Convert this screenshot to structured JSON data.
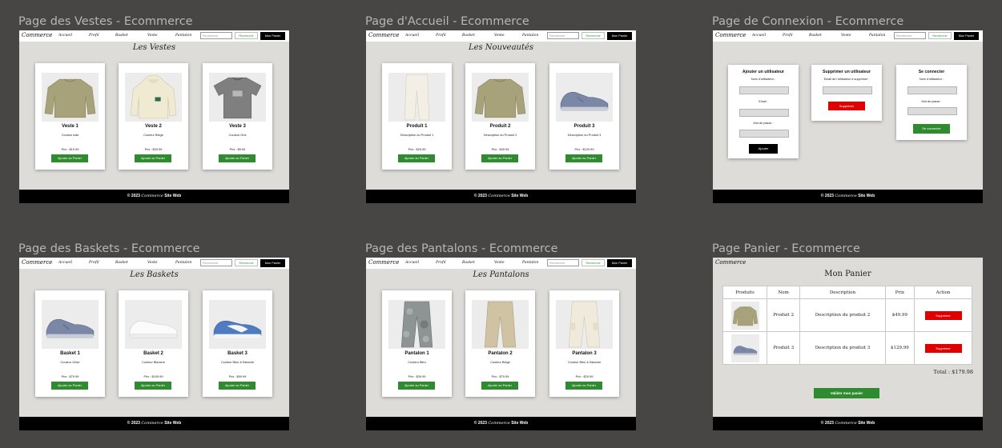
{
  "frames": [
    {
      "title": "Page des Vestes - Ecommerce",
      "heading": "Les Vestes",
      "products": [
        {
          "name": "Veste 1",
          "desc": "Couleur kaki",
          "price": "Prix : $19.99",
          "image": "sweater-khaki"
        },
        {
          "name": "Veste 2",
          "desc": "Couleur Beige",
          "price": "Prix : $29.99",
          "image": "hoodie-beige"
        },
        {
          "name": "Veste 3",
          "desc": "Couleur Gris",
          "price": "Prix : $9.99",
          "image": "tshirt-grey"
        }
      ]
    },
    {
      "title": "Page d'Accueil - Ecommerce",
      "heading": "Les Nouveautés",
      "products": [
        {
          "name": "Produit 1",
          "desc": "Description du Produit 1",
          "price": "Prix : $29.99",
          "image": "pants-white"
        },
        {
          "name": "Produit 2",
          "desc": "Description du Produit 2",
          "price": "Prix : $49.99",
          "image": "sweater-khaki"
        },
        {
          "name": "Produit 3",
          "desc": "Description du Produit 3",
          "price": "Prix : $129.99",
          "image": "sneaker-grey"
        }
      ]
    },
    {
      "title": "Page de Connexion - Ecommerce"
    },
    {
      "title": "Page des Baskets - Ecommerce",
      "heading": "Les Baskets",
      "products": [
        {
          "name": "Basket 1",
          "desc": "Couleur Grise",
          "price": "Prix : $79.99",
          "image": "sneaker-grey"
        },
        {
          "name": "Basket 2",
          "desc": "Couleur Blanche",
          "price": "Prix : $109.99",
          "image": "sneaker-white"
        },
        {
          "name": "Basket 3",
          "desc": "Couleur Bleu & Blanche",
          "price": "Prix : $99.99",
          "image": "sneaker-blue"
        }
      ]
    },
    {
      "title": "Page des Pantalons - Ecommerce",
      "heading": "Les Pantalons",
      "products": [
        {
          "name": "Pantalon 1",
          "desc": "Couleur Bleu",
          "price": "Prix : $39.99",
          "image": "pants-camo"
        },
        {
          "name": "Pantalon 2",
          "desc": "Couleur Beige",
          "price": "Prix : $79.99",
          "image": "pants-beige"
        },
        {
          "name": "Pantalon 3",
          "desc": "Couleur Bleu & Blanche",
          "price": "Prix : $29.99",
          "image": "pants-cream"
        }
      ]
    },
    {
      "title": "Page Panier - Ecommerce"
    }
  ],
  "nav": {
    "logo": "Commerce",
    "links": [
      "Accueil",
      "Profil",
      "Basket",
      "Veste",
      "Pantalon"
    ],
    "search_placeholder": "Rechercher",
    "search_button": "Recherche",
    "cart_button": "Mon Panier"
  },
  "common": {
    "add_to_cart": "Ajouter au Panier",
    "footer_year": "© 2023",
    "footer_logo": "Commerce",
    "footer_site": "Site Web"
  },
  "login": {
    "add_user": {
      "title": "Ajouter un utilisateur",
      "name_label": "Nom d'utilisateur :",
      "email_label": "Email :",
      "password_label": "Mot de passe :",
      "button": "Ajouter"
    },
    "delete_user": {
      "title": "Supprimer un utilisateur",
      "email_label": "Email de l'utilisateur à supprimer :",
      "button": "Supprimer"
    },
    "connect": {
      "title": "Se connecter",
      "name_label": "Nom d'utilisateur :",
      "password_label": "Mot de passe :",
      "button": "Se connecter"
    }
  },
  "cart": {
    "heading": "Mon Panier",
    "columns": [
      "Produits",
      "Nom",
      "Description",
      "Prix",
      "Action"
    ],
    "rows": [
      {
        "image": "sweater-khaki",
        "name": "Produit 2",
        "desc": "Description du produit 2",
        "price": "$49.99",
        "action": "Supprimer"
      },
      {
        "image": "sneaker-grey",
        "name": "Produit 3",
        "desc": "Description du produit 3",
        "price": "$129.99",
        "action": "Supprimer"
      }
    ],
    "total": "Total : $179.98",
    "validate": "Valider mon panier"
  },
  "colors": {
    "background": "#474644",
    "frame": "#dedcd9",
    "accent_green": "#2e8b2e",
    "danger_red": "#e00000",
    "black": "#000000"
  }
}
